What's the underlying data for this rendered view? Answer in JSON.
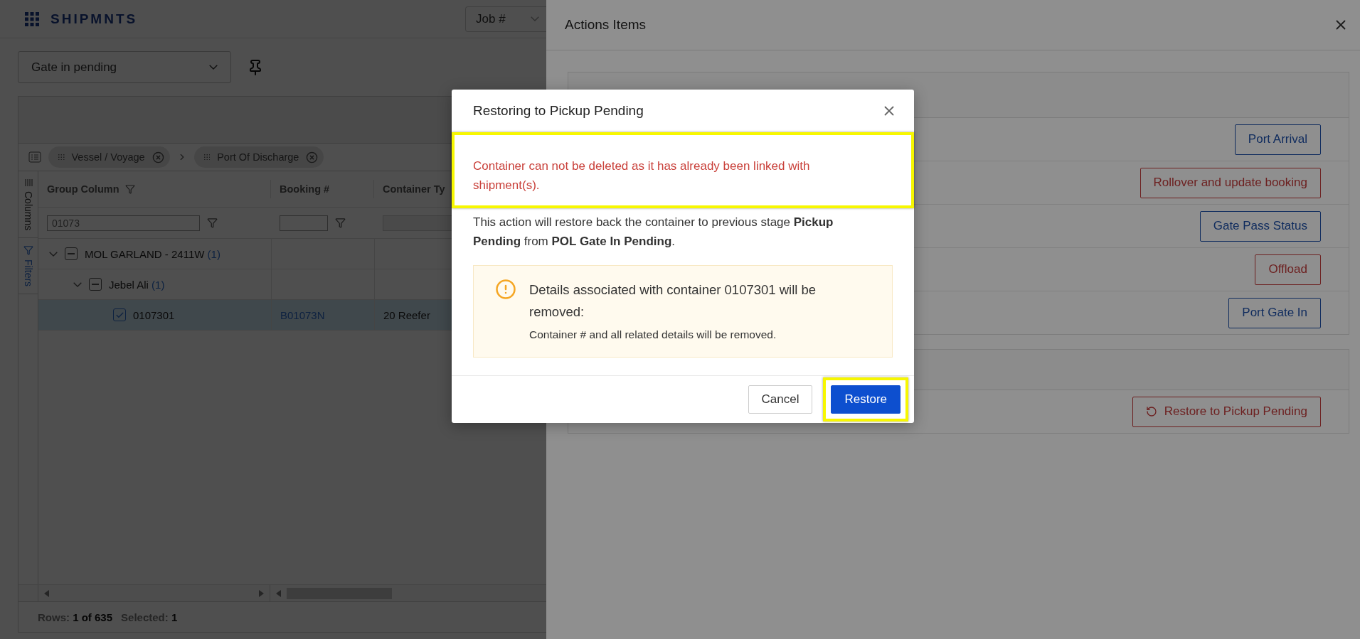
{
  "app": {
    "logo": "SHIPMNTS",
    "search_select": "Job #",
    "view_select": "Gate in pending",
    "grid": {
      "group_chips": [
        "Vessel / Voyage",
        "Port Of Discharge"
      ],
      "side_tabs": [
        {
          "label": "Columns",
          "kind": "columns",
          "selected": false
        },
        {
          "label": "Filters",
          "kind": "filters",
          "selected": true
        }
      ],
      "columns": [
        {
          "label": "Group Column",
          "filter": "01073"
        },
        {
          "label": "Booking #"
        },
        {
          "label": "Container Ty"
        }
      ],
      "rows": [
        {
          "label": "MOL GARLAND - 2411W",
          "count": "(1)",
          "expanded": true,
          "checked": false,
          "indeterminate": true,
          "selected": false,
          "children": [
            {
              "label": "Jebel Ali",
              "count": "(1)",
              "expanded": true,
              "checked": false,
              "indeterminate": true,
              "selected": false,
              "children": [
                {
                  "label": "0107301",
                  "booking": "B01073N",
                  "type": "20 Reefer",
                  "checked": true,
                  "selected": true
                }
              ]
            }
          ]
        }
      ],
      "footer": {
        "rows_label": "Rows:",
        "rows_value": "1 of 635",
        "selected_label": "Selected:",
        "selected_value": "1"
      }
    }
  },
  "drawer": {
    "title": "Actions Items",
    "sections": [
      {
        "actions": [
          {
            "label": "Port Arrival",
            "kind": "primary"
          },
          {
            "label": "Rollover and update booking",
            "kind": "danger"
          },
          {
            "label": "Gate Pass Status",
            "kind": "primary"
          },
          {
            "label": "Offload",
            "kind": "danger"
          },
          {
            "label": "Port Gate In",
            "kind": "primary"
          }
        ]
      },
      {
        "actions": [
          {
            "label": "Restore to Pickup Pending",
            "kind": "restore"
          }
        ]
      }
    ]
  },
  "modal": {
    "title": "Restoring to Pickup Pending",
    "error": {
      "text": "Container can not be deleted as it has already been linked with shipment(s).",
      "highlighted": true
    },
    "body": "This action will restore back the container to previous stage **Pickup Pending** from **POL Gate In Pending**.",
    "warning": {
      "title": "Details associated with container 0107301 will be removed:",
      "detail": "Container # and all related details will be removed."
    },
    "buttons": [
      {
        "label": "Cancel",
        "kind": "secondary",
        "highlighted": false
      },
      {
        "label": "Restore",
        "kind": "primary",
        "highlighted": true
      }
    ]
  }
}
